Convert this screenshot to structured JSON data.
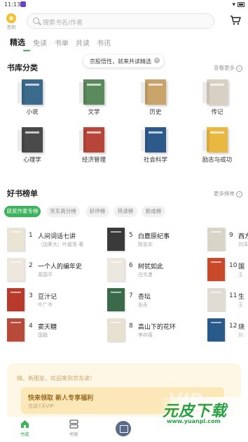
{
  "status_bar": {
    "time": "11:13"
  },
  "header": {
    "sign_in_label": "签到",
    "search_placeholder": "搜索书名/作者"
  },
  "tabs": [
    {
      "label": "精选",
      "active": true
    },
    {
      "label": "免读",
      "active": false
    },
    {
      "label": "书单",
      "active": false
    },
    {
      "label": "共读",
      "active": false
    },
    {
      "label": "书讯",
      "active": false
    }
  ],
  "tooltip": {
    "text": "京股悟性，就来共读精选"
  },
  "library": {
    "title": "书库分类",
    "more": "查看更多",
    "categories": [
      {
        "label": "小说",
        "color": "#3a6a8c"
      },
      {
        "label": "文学",
        "color": "#5b8a5e"
      },
      {
        "label": "历史",
        "color": "#c8a46a"
      },
      {
        "label": "传记",
        "color": "#d9d0c4"
      },
      {
        "label": "心理学",
        "color": "#4a4a4a"
      },
      {
        "label": "经济管理",
        "color": "#b8453a"
      },
      {
        "label": "社会科学",
        "color": "#2d5a8a"
      },
      {
        "label": "励志与成功",
        "color": "#e8b840"
      }
    ]
  },
  "rankings": {
    "title": "好书榜单",
    "more": "更多榜单",
    "chips": [
      {
        "label": "获奖作家专榜",
        "active": true
      },
      {
        "label": "京东高分榜",
        "active": false
      },
      {
        "label": "好评榜",
        "active": false
      },
      {
        "label": "热读榜",
        "active": false
      },
      {
        "label": "新成榜",
        "active": false
      }
    ],
    "items": [
      {
        "num": "1",
        "title": "人间词话七讲",
        "author": "（加拿大）叶嘉莹 著",
        "color": "#e9e4d4"
      },
      {
        "num": "2",
        "title": "一个人的编年史",
        "author": "周国平",
        "color": "#ece6dc"
      },
      {
        "num": "3",
        "title": "豆汁记",
        "author": "叶广岑",
        "color": "#b83a2a"
      },
      {
        "num": "4",
        "title": "窦天糖",
        "author": "国籍",
        "color": "#b84a3a"
      },
      {
        "num": "5",
        "title": "白鹿原纪事",
        "author": "陈忠实",
        "color": "#3a3a3a"
      },
      {
        "num": "6",
        "title": "树犹如此",
        "author": "白先勇",
        "color": "#ece8e0"
      },
      {
        "num": "7",
        "title": "杏坛",
        "author": "张永",
        "color": "#3a6a4a"
      },
      {
        "num": "8",
        "title": "高山下的花环",
        "author": "李存葆",
        "color": "#e8e0d0"
      },
      {
        "num": "9",
        "title": "西方",
        "author": "刘泽",
        "color": "#d8d4c8"
      },
      {
        "num": "10",
        "title": "国",
        "author": "王",
        "color": "#c84a2a"
      },
      {
        "num": "11",
        "title": "生",
        "author": "王",
        "color": "#e0dcd4"
      },
      {
        "num": "12",
        "title": "烧",
        "author": "刘",
        "color": "#2a5a8a"
      }
    ]
  },
  "promo": {
    "greeting": "嗨，新朋友，欢迎来到京东读！",
    "title": "快来领取 新人专享福利",
    "subtitle": "兑送7天VIP",
    "badge": "VIP"
  },
  "bottom_nav": [
    {
      "label": "书城",
      "active": true
    },
    {
      "label": "书架",
      "active": false
    }
  ],
  "watermark": {
    "main": "元皮下载",
    "url": "www.yuanpi.com"
  },
  "colors": {
    "accent": "#3bb35a",
    "promo_bg": "#fff7e6"
  }
}
